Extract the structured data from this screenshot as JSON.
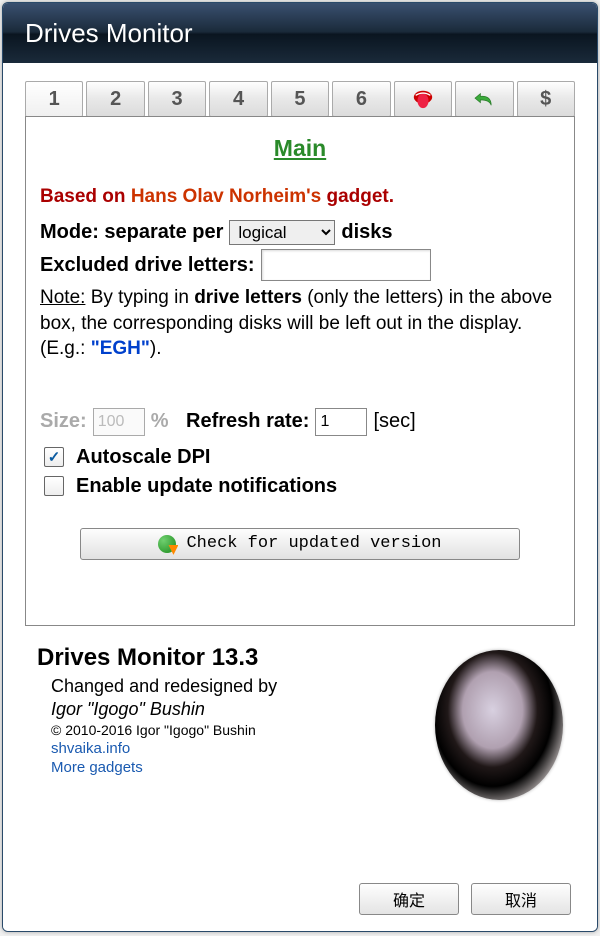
{
  "window": {
    "title": "Drives Monitor"
  },
  "tabs": {
    "items": [
      "1",
      "2",
      "3",
      "4",
      "5",
      "6"
    ],
    "active": 0,
    "extra": {
      "tongue": "tongue-icon",
      "undo": "undo-icon",
      "dollar": "$"
    }
  },
  "main": {
    "title": "Main",
    "credit": {
      "based": "Based on ",
      "name": "Hans Olav Norheim's",
      "gadget": " gadget."
    },
    "mode": {
      "label_before": "Mode: separate per",
      "options": [
        "logical"
      ],
      "selected": "logical",
      "label_after": "disks"
    },
    "excluded": {
      "label": "Excluded drive letters:",
      "value": ""
    },
    "note": {
      "label": "Note:",
      "text_a": " By typing in ",
      "bold": "drive letters",
      "text_b": " (only the letters) in the above box, the corresponding disks will be left out in the display. (E.g.: ",
      "egh": "\"EGH\"",
      "text_c": ")."
    },
    "size": {
      "label": "Size:",
      "value": "100",
      "pct": "%"
    },
    "refresh": {
      "label": "Refresh rate:",
      "value": "1",
      "unit": "[sec]"
    },
    "autoscale": {
      "label": "Autoscale DPI",
      "checked": true
    },
    "updates": {
      "label": "Enable update notifications",
      "checked": false
    },
    "check_btn": "Check for updated version"
  },
  "about": {
    "title": "Drives Monitor 13.3",
    "changed": "Changed and redesigned by",
    "author": "Igor \"Igogo\" Bushin",
    "copyright": "© 2010-2016 Igor \"Igogo\" Bushin",
    "link1": "shvaika.info",
    "link2": "More gadgets"
  },
  "footer": {
    "ok": "确定",
    "cancel": "取消"
  }
}
